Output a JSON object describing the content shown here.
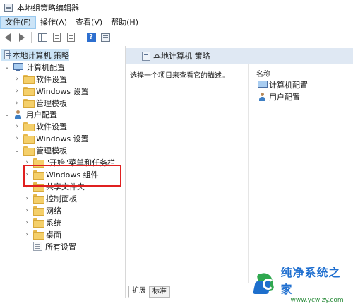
{
  "window": {
    "title": "本地组策略编辑器"
  },
  "menubar": {
    "items": [
      {
        "label": "文件(F)"
      },
      {
        "label": "操作(A)"
      },
      {
        "label": "查看(V)"
      },
      {
        "label": "帮助(H)"
      }
    ]
  },
  "toolbar": {
    "help_glyph": "?"
  },
  "tree": {
    "root": "本地计算机 策略",
    "computer_config": "计算机配置",
    "cc_software": "软件设置",
    "cc_windows": "Windows 设置",
    "cc_admin": "管理模板",
    "user_config": "用户配置",
    "uc_software": "软件设置",
    "uc_windows": "Windows 设置",
    "uc_admin": "管理模板",
    "admin_children": [
      {
        "label": "\"开始\"菜单和任务栏"
      },
      {
        "label": "Windows 组件"
      },
      {
        "label": "共享文件夹"
      },
      {
        "label": "控制面板"
      },
      {
        "label": "网络"
      },
      {
        "label": "系统"
      },
      {
        "label": "桌面"
      },
      {
        "label": "所有设置"
      }
    ]
  },
  "right": {
    "header": "本地计算机 策略",
    "description": "选择一个项目来查看它的描述。",
    "column_header": "名称",
    "items": [
      {
        "label": "计算机配置"
      },
      {
        "label": "用户配置"
      }
    ]
  },
  "tabs": [
    {
      "label": "扩展"
    },
    {
      "label": "标准"
    }
  ],
  "watermark": {
    "title": "纯净系统之家",
    "url": "www.ycwjzy.com"
  },
  "colors": {
    "selection": "#cce4f7",
    "header_bg": "#dfe8f3",
    "highlight_box": "#e02020",
    "folder": "#f4cf6a"
  }
}
